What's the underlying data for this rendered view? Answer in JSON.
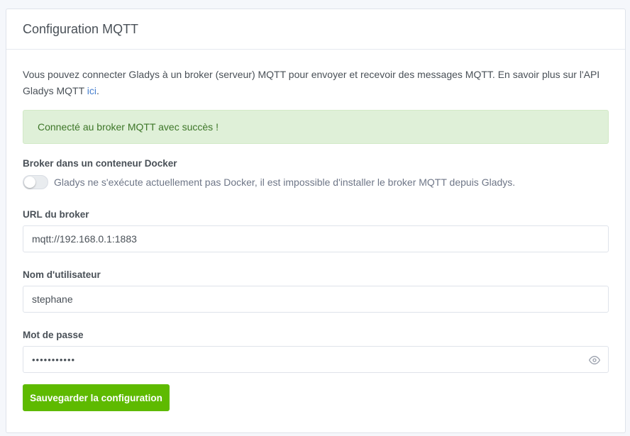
{
  "header": {
    "title": "Configuration MQTT"
  },
  "intro": {
    "text": "Vous pouvez connecter Gladys à un broker (serveur) MQTT pour envoyer et recevoir des messages MQTT. En savoir plus sur l'API Gladys MQTT ",
    "link_text": "ici",
    "suffix": "."
  },
  "alert": {
    "text": "Connecté au broker MQTT avec succès !",
    "color": "#dff0d8"
  },
  "docker": {
    "label": "Broker dans un conteneur Docker",
    "toggle_enabled": false,
    "description": "Gladys ne s'exécute actuellement pas Docker, il est impossible d'installer le broker MQTT depuis Gladys."
  },
  "url": {
    "label": "URL du broker",
    "value": "mqtt://192.168.0.1:1883"
  },
  "username": {
    "label": "Nom d'utilisateur",
    "value": "stephane"
  },
  "password": {
    "label": "Mot de passe",
    "masked_value": "•••••••••••",
    "reveal_icon": "eye-icon"
  },
  "save_button": {
    "label": "Sauvegarder la configuration",
    "color": "#5eba00"
  }
}
